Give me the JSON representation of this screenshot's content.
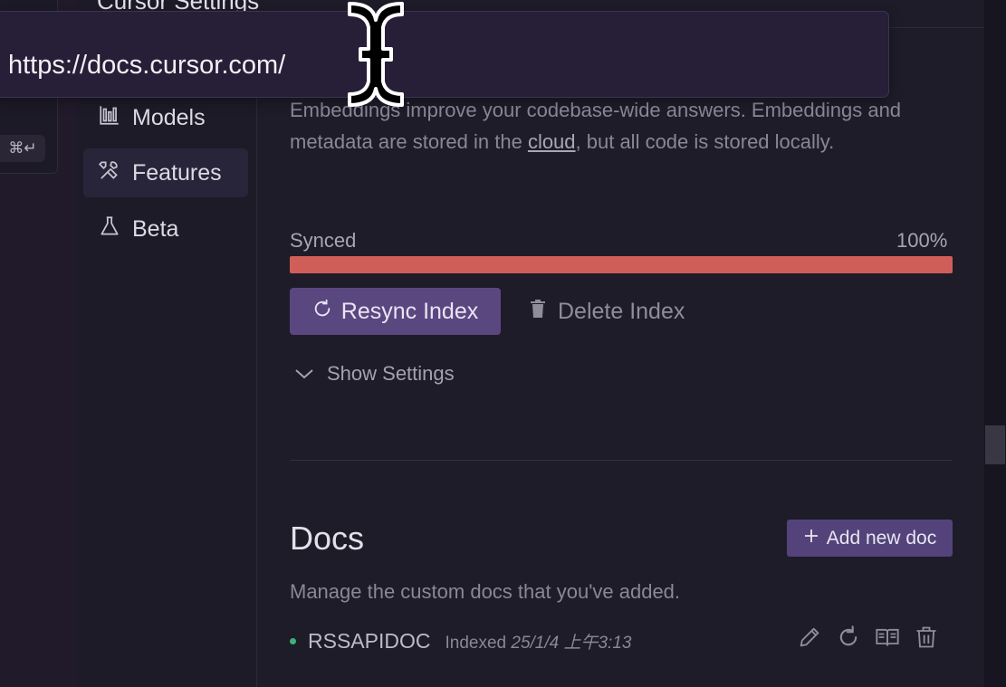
{
  "panel_title": "Cursor Settings",
  "url_bar": {
    "value": "https://docs.cursor.com/"
  },
  "far_left": {
    "shortcut_hint": "⌘↵"
  },
  "sidebar": {
    "items": [
      {
        "label": "Models",
        "icon": "bar-chart-icon",
        "active": false
      },
      {
        "label": "Features",
        "icon": "tools-icon",
        "active": true
      },
      {
        "label": "Beta",
        "icon": "flask-icon",
        "active": false
      }
    ]
  },
  "codebase": {
    "description_part1": "Embeddings improve your codebase-wide answers. Embeddings and metadata are stored in the ",
    "description_link": "cloud",
    "description_part2": ", but all code is stored locally.",
    "sync_status": "Synced",
    "sync_percent_label": "100%",
    "sync_progress": 1.0,
    "resync_label": "Resync Index",
    "delete_label": "Delete Index",
    "show_settings_label": "Show Settings"
  },
  "docs": {
    "title": "Docs",
    "add_label": "Add new doc",
    "description": "Manage the custom docs that you've added.",
    "items": [
      {
        "name": "RSSAPIDOC",
        "indexed_prefix": "Indexed",
        "indexed_time": "25/1/4 上午3:13",
        "status_color": "#3fb27a"
      }
    ]
  },
  "colors": {
    "accent": "#5a4780",
    "progress": "#d05e58",
    "status_ok": "#3fb27a"
  }
}
